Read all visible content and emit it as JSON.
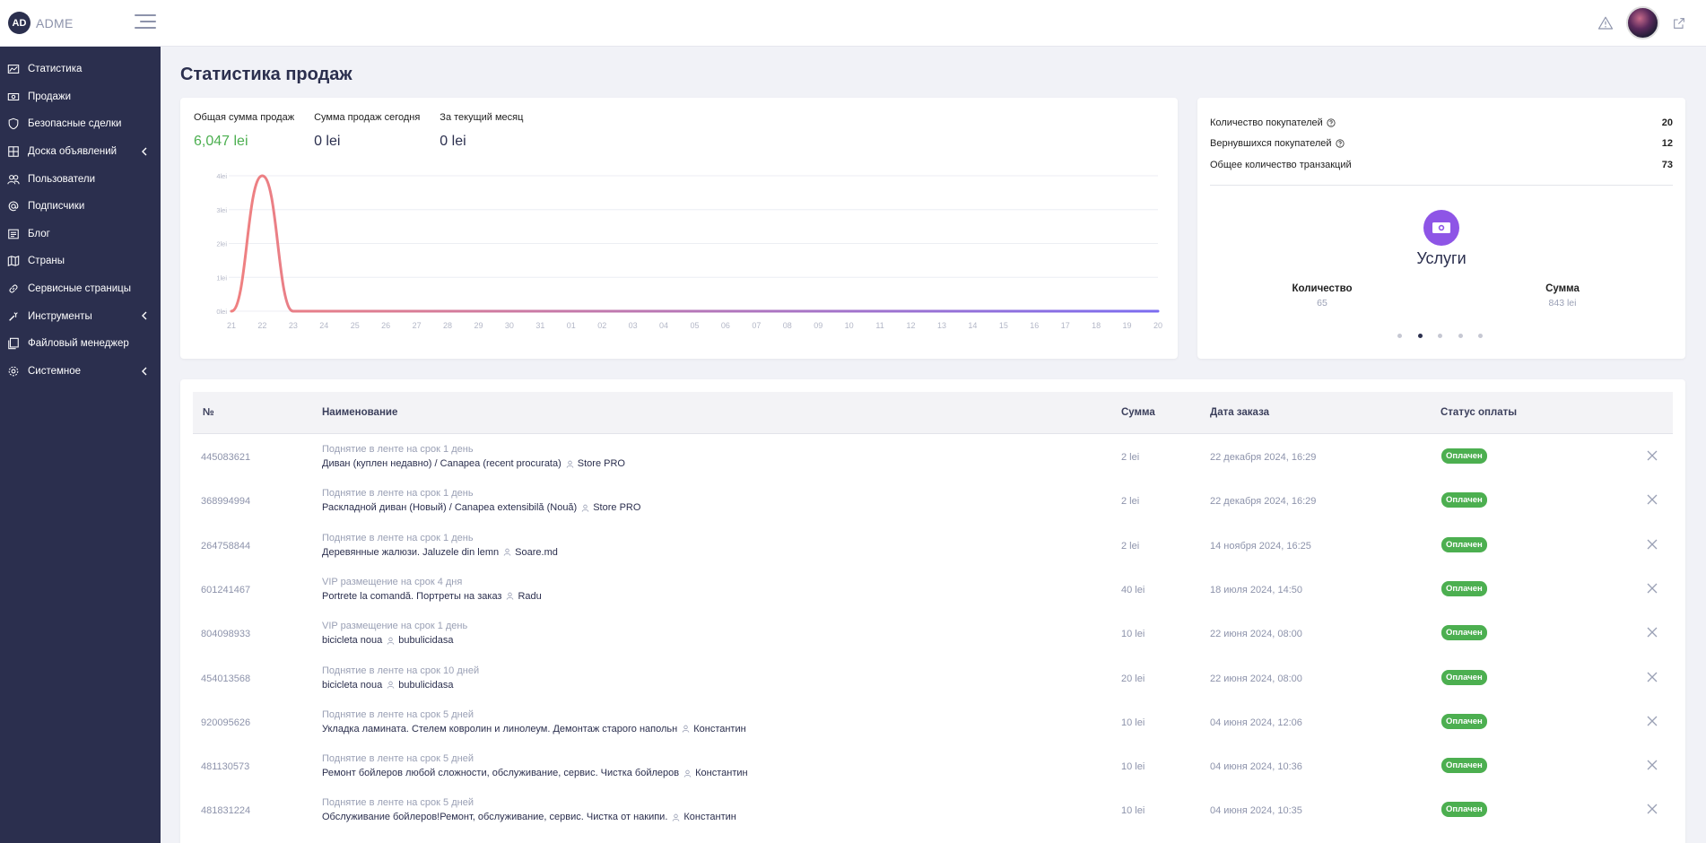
{
  "header": {
    "logo_badge": "AD",
    "logo_text": "ADME"
  },
  "sidebar": {
    "items": [
      {
        "label": "Статистика",
        "icon": "chart-icon"
      },
      {
        "label": "Продажи",
        "icon": "cash-icon"
      },
      {
        "label": "Безопасные сделки",
        "icon": "shield-icon"
      },
      {
        "label": "Доска объявлений",
        "icon": "grid-icon",
        "has_submenu": true
      },
      {
        "label": "Пользователи",
        "icon": "users-icon"
      },
      {
        "label": "Подписчики",
        "icon": "at-icon"
      },
      {
        "label": "Блог",
        "icon": "blog-icon"
      },
      {
        "label": "Страны",
        "icon": "map-icon"
      },
      {
        "label": "Сервисные страницы",
        "icon": "link-icon"
      },
      {
        "label": "Инструменты",
        "icon": "tools-icon",
        "has_submenu": true
      },
      {
        "label": "Файловый менеджер",
        "icon": "files-icon"
      },
      {
        "label": "Системное",
        "icon": "gear-icon",
        "has_submenu": true
      }
    ]
  },
  "page": {
    "title": "Статистика продаж"
  },
  "kpis": [
    {
      "label": "Общая сумма продаж",
      "value": "6,047 lei",
      "highlight": true
    },
    {
      "label": "Сумма продаж сегодня",
      "value": "0 lei",
      "highlight": false
    },
    {
      "label": "За текущий месяц",
      "value": "0 lei",
      "highlight": false
    }
  ],
  "chart_data": {
    "type": "line",
    "x": [
      "21",
      "22",
      "23",
      "24",
      "25",
      "26",
      "27",
      "28",
      "29",
      "30",
      "31",
      "01",
      "02",
      "03",
      "04",
      "05",
      "06",
      "07",
      "08",
      "09",
      "10",
      "11",
      "12",
      "13",
      "14",
      "15",
      "16",
      "17",
      "18",
      "19",
      "20"
    ],
    "series": [
      {
        "values": [
          0,
          4,
          0,
          0,
          0,
          0,
          0,
          0,
          0,
          0,
          0,
          0,
          0,
          0,
          0,
          0,
          0,
          0,
          0,
          0,
          0,
          0,
          0,
          0,
          0,
          0,
          0,
          0,
          0,
          0,
          0
        ]
      }
    ],
    "y_ticks": [
      "0lei",
      "1lei",
      "2lei",
      "3lei",
      "4lei"
    ],
    "ylim": [
      0,
      4
    ],
    "grid": true,
    "colors": {
      "start": "#f08080",
      "end": "#7b6cf0"
    }
  },
  "stats": {
    "rows": [
      {
        "label": "Количество покупателей",
        "value": "20",
        "help": true
      },
      {
        "label": "Вернувшихся покупателей",
        "value": "12",
        "help": true
      },
      {
        "label": "Общее количество транзакций",
        "value": "73",
        "help": false
      }
    ],
    "service": {
      "title": "Услуги",
      "count_label": "Количество",
      "count_value": "65",
      "sum_label": "Сумма",
      "sum_value": "843 lei",
      "icon": "money-icon",
      "icon_color": "#8e55e6"
    },
    "carousel": {
      "total": 5,
      "active": 1
    }
  },
  "table": {
    "headers": {
      "num": "№",
      "name": "Наименование",
      "sum": "Сумма",
      "date": "Дата заказа",
      "status": "Статус оплаты"
    },
    "rows": [
      {
        "num": "445083621",
        "service": "Поднятие в ленте на срок 1 день",
        "item": "Диван (куплен недавно) / Canapea (recent procurata)",
        "user": "Store PRO",
        "sum": "2 lei",
        "date": "22 декабря 2024, 16:29",
        "status": "Оплачен"
      },
      {
        "num": "368994994",
        "service": "Поднятие в ленте на срок 1 день",
        "item": "Раскладной диван (Новый) / Canapea extensibilă (Nouă)",
        "user": "Store PRO",
        "sum": "2 lei",
        "date": "22 декабря 2024, 16:29",
        "status": "Оплачен"
      },
      {
        "num": "264758844",
        "service": "Поднятие в ленте на срок 1 день",
        "item": "Деревянные жалюзи. Jaluzele din lemn",
        "user": "Soare.md",
        "sum": "2 lei",
        "date": "14 ноября 2024, 16:25",
        "status": "Оплачен"
      },
      {
        "num": "601241467",
        "service": "VIP размещение на срок 4 дня",
        "item": "Portrete la comandă. Портреты на заказ",
        "user": "Radu",
        "sum": "40 lei",
        "date": "18 июля 2024, 14:50",
        "status": "Оплачен"
      },
      {
        "num": "804098933",
        "service": "VIP размещение на срок 1 день",
        "item": "bicicleta noua",
        "user": "bubulicidasa",
        "sum": "10 lei",
        "date": "22 июня 2024, 08:00",
        "status": "Оплачен"
      },
      {
        "num": "454013568",
        "service": "Поднятие в ленте на срок 10 дней",
        "item": "bicicleta noua",
        "user": "bubulicidasa",
        "sum": "20 lei",
        "date": "22 июня 2024, 08:00",
        "status": "Оплачен"
      },
      {
        "num": "920095626",
        "service": "Поднятие в ленте на срок 5 дней",
        "item": "Укладка ламината. Стелем ковролин и линолеум. Демонтаж старого напольн",
        "user": "Константин",
        "sum": "10 lei",
        "date": "04 июня 2024, 12:06",
        "status": "Оплачен"
      },
      {
        "num": "481130573",
        "service": "Поднятие в ленте на срок 5 дней",
        "item": "Ремонт бойлеров любой сложности, обслуживание, сервис. Чистка бойлеров",
        "user": "Константин",
        "sum": "10 lei",
        "date": "04 июня 2024, 10:36",
        "status": "Оплачен"
      },
      {
        "num": "481831224",
        "service": "Поднятие в ленте на срок 5 дней",
        "item": "Обслуживание бойлеров!Ремонт, обслуживание, сервис. Чистка от накипи.",
        "user": "Константин",
        "sum": "10 lei",
        "date": "04 июня 2024, 10:35",
        "status": "Оплачен"
      }
    ]
  }
}
